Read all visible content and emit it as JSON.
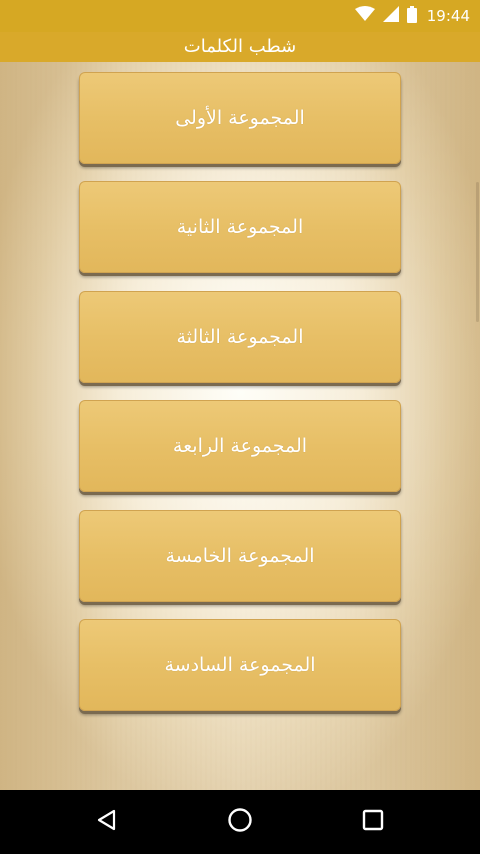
{
  "status_bar": {
    "time": "19:44",
    "icons": [
      "wifi-icon",
      "cell-signal-icon",
      "battery-icon"
    ]
  },
  "header": {
    "title": "شطب الكلمات"
  },
  "groups": [
    {
      "label": "المجموعة الأولى"
    },
    {
      "label": "المجموعة الثانية"
    },
    {
      "label": "المجموعة الثالثة"
    },
    {
      "label": "المجموعة الرابعة"
    },
    {
      "label": "المجموعة الخامسة"
    },
    {
      "label": "المجموعة السادسة"
    }
  ],
  "nav_bar": {
    "icons": [
      "back-icon",
      "home-icon",
      "recents-icon"
    ]
  },
  "colors": {
    "accent": "#d9a92a",
    "button": "#e7bf66",
    "text_on_accent": "#ffffff"
  }
}
